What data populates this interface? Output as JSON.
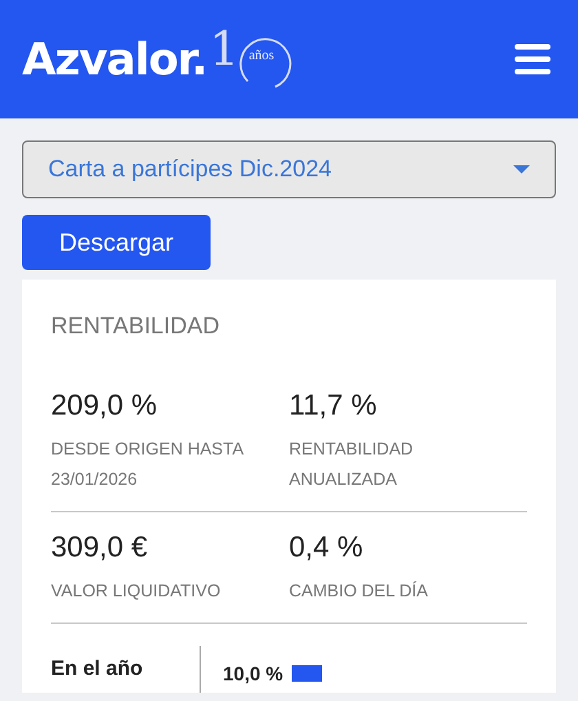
{
  "header": {
    "brand": "Azvalor.",
    "anniversary_digit": "1",
    "anniversary_label": "años"
  },
  "document_select": {
    "value": "Carta a partícipes Dic.2024"
  },
  "download_button": "Descargar",
  "card": {
    "title": "RENTABILIDAD",
    "stats": [
      {
        "value": "209,0 %",
        "label": "DESDE ORIGEN HASTA 23/01/2026"
      },
      {
        "value": "11,7 %",
        "label": "RENTABILIDAD ANUALIZADA"
      },
      {
        "value": "309,0 €",
        "label": "VALOR LIQUIDATIVO"
      },
      {
        "value": "0,4 %",
        "label": "CAMBIO DEL DÍA"
      }
    ],
    "periods": [
      {
        "label": "En el año",
        "reading": "10,0 %"
      }
    ]
  }
}
